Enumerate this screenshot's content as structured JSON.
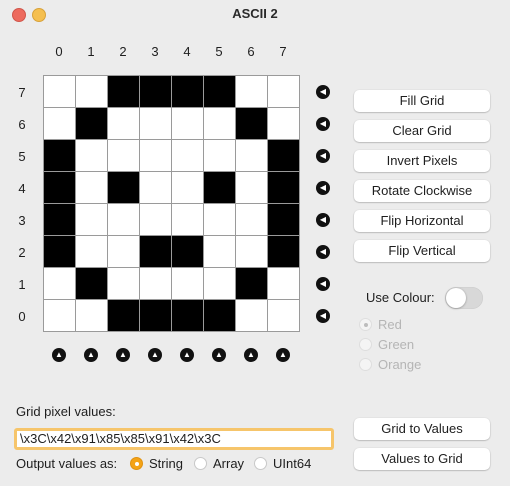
{
  "window": {
    "title": "ASCII 2"
  },
  "grid": {
    "column_labels": [
      "0",
      "1",
      "2",
      "3",
      "4",
      "5",
      "6",
      "7"
    ],
    "row_labels": [
      "7",
      "6",
      "5",
      "4",
      "3",
      "2",
      "1",
      "0"
    ],
    "rows": [
      [
        0,
        0,
        1,
        1,
        1,
        1,
        0,
        0
      ],
      [
        0,
        1,
        0,
        0,
        0,
        0,
        1,
        0
      ],
      [
        1,
        0,
        0,
        0,
        0,
        0,
        0,
        1
      ],
      [
        1,
        0,
        1,
        0,
        0,
        1,
        0,
        1
      ],
      [
        1,
        0,
        0,
        0,
        0,
        0,
        0,
        1
      ],
      [
        1,
        0,
        0,
        1,
        1,
        0,
        0,
        1
      ],
      [
        0,
        1,
        0,
        0,
        0,
        0,
        1,
        0
      ],
      [
        0,
        0,
        1,
        1,
        1,
        1,
        0,
        0
      ]
    ],
    "row_button_icon": "triangle-left",
    "column_button_icon": "triangle-up"
  },
  "actions": {
    "fill_grid": "Fill Grid",
    "clear_grid": "Clear Grid",
    "invert_pixels": "Invert Pixels",
    "rotate_clockwise": "Rotate Clockwise",
    "flip_horizontal": "Flip Horizontal",
    "flip_vertical": "Flip Vertical"
  },
  "colour": {
    "label": "Use Colour:",
    "enabled": false,
    "options": [
      "Red",
      "Green",
      "Orange"
    ],
    "selected": "Red"
  },
  "values": {
    "label": "Grid pixel values:",
    "text": "\\x3C\\x42\\x91\\x85\\x85\\x91\\x42\\x3C",
    "output_label": "Output values as:",
    "output_options": [
      "String",
      "Array",
      "UInt64"
    ],
    "output_selected": "String",
    "grid_to_values": "Grid to Values",
    "values_to_grid": "Values to Grid"
  },
  "colors": {
    "pixel_on": "#000000",
    "pixel_off": "#ffffff",
    "accent": "#f4a316"
  }
}
